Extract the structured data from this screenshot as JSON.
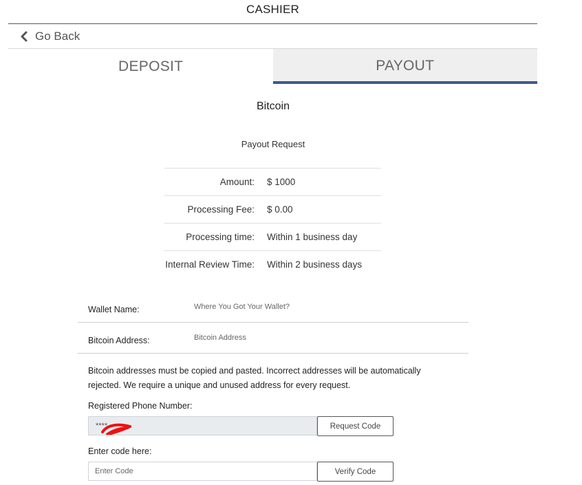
{
  "header": {
    "title": "CASHIER"
  },
  "nav": {
    "back_label": "Go Back"
  },
  "tabs": [
    {
      "label": "DEPOSIT",
      "active": false
    },
    {
      "label": "PAYOUT",
      "active": true
    }
  ],
  "method": {
    "title": "Bitcoin",
    "subtitle": "Payout Request"
  },
  "summary": [
    {
      "label": "Amount:",
      "value": "$ 1000"
    },
    {
      "label": "Processing Fee:",
      "value": "$ 0.00"
    },
    {
      "label": "Processing time:",
      "value": "Within 1 business day"
    },
    {
      "label": "Internal Review Time:",
      "value": "Within 2 business days"
    }
  ],
  "form": {
    "wallet_name": {
      "label": "Wallet Name:",
      "placeholder": "Where You Got Your Wallet?",
      "value": ""
    },
    "bitcoin_address": {
      "label": "Bitcoin Address:",
      "placeholder": "Bitcoin Address",
      "value": ""
    },
    "notice": "Bitcoin addresses must be copied and pasted. Incorrect addresses will be automatically rejected. We require a unique and unused address for every request.",
    "phone": {
      "label": "Registered Phone Number:",
      "value": "****"
    },
    "request_code_label": "Request Code",
    "code": {
      "label": "Enter code here:",
      "placeholder": "Enter Code",
      "value": ""
    },
    "verify_code_label": "Verify Code"
  },
  "colors": {
    "tab_active_bg": "#efefef",
    "tab_active_border": "#3d5a8a",
    "redaction": "#ee1111"
  }
}
